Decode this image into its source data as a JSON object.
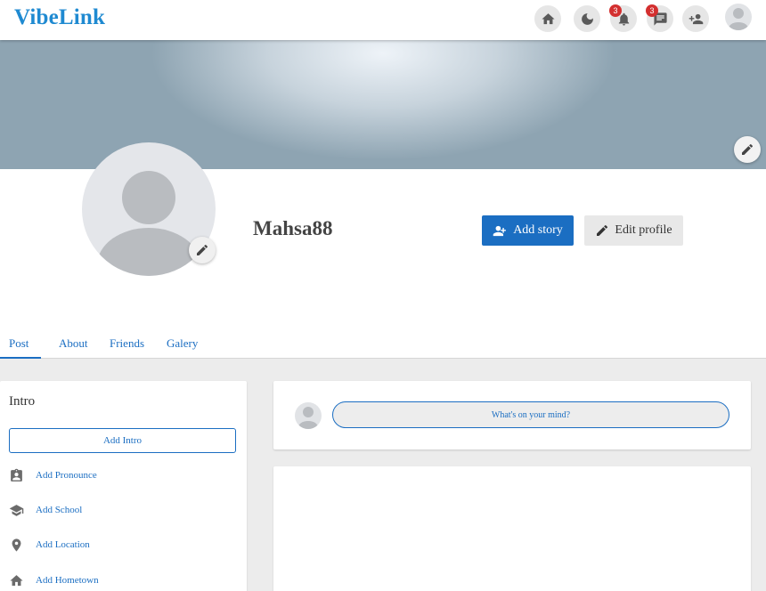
{
  "app": {
    "name": "VibeLink"
  },
  "nav": {
    "notifications_count": "3",
    "messages_count": "3"
  },
  "profile": {
    "username": "Mahsa88",
    "add_story_label": "Add story",
    "edit_profile_label": "Edit profile"
  },
  "tabs": [
    {
      "label": "Post",
      "active": true
    },
    {
      "label": "About",
      "active": false
    },
    {
      "label": "Friends",
      "active": false
    },
    {
      "label": "Galery",
      "active": false
    }
  ],
  "intro": {
    "title": "Intro",
    "add_intro_label": "Add Intro",
    "items": [
      {
        "label": "Add Pronounce",
        "icon": "badge-icon"
      },
      {
        "label": "Add School",
        "icon": "school-icon"
      },
      {
        "label": "Add Location",
        "icon": "location-pin-icon"
      },
      {
        "label": "Add Hometown",
        "icon": "home-icon"
      }
    ]
  },
  "composer": {
    "placeholder": "What's on your mind?"
  },
  "colors": {
    "brand": "#1f8ad1",
    "primary": "#1b6ec2",
    "badge": "#d32f2f"
  }
}
